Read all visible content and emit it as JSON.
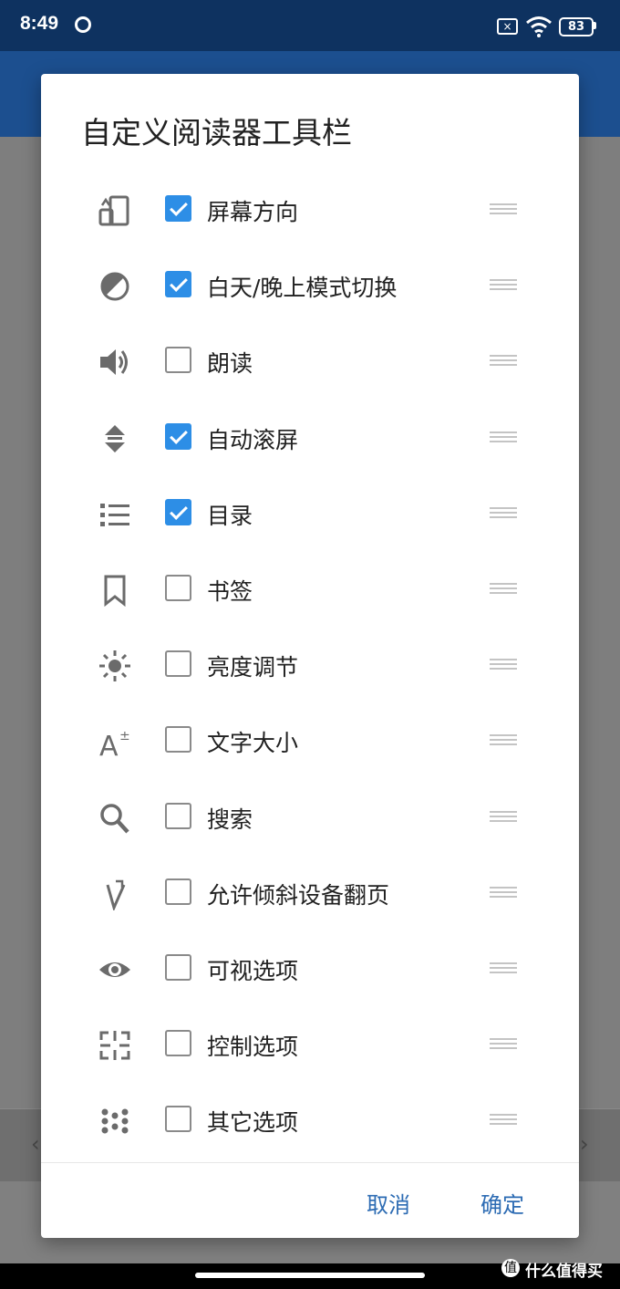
{
  "status_bar": {
    "time": "8:49",
    "battery": "83",
    "sim_icon": "sim-card-x-icon",
    "wifi_icon": "wifi-icon"
  },
  "dialog": {
    "title": "自定义阅读器工具栏",
    "items": [
      {
        "label": "屏幕方向",
        "checked": true,
        "icon": "screen-rotation-icon"
      },
      {
        "label": "白天/晚上模式切换",
        "checked": true,
        "icon": "day-night-icon"
      },
      {
        "label": "朗读",
        "checked": false,
        "icon": "speaker-icon"
      },
      {
        "label": "自动滚屏",
        "checked": true,
        "icon": "auto-scroll-icon"
      },
      {
        "label": "目录",
        "checked": true,
        "icon": "toc-list-icon"
      },
      {
        "label": "书签",
        "checked": false,
        "icon": "bookmark-icon"
      },
      {
        "label": "亮度调节",
        "checked": false,
        "icon": "brightness-icon"
      },
      {
        "label": "文字大小",
        "checked": false,
        "icon": "text-size-icon"
      },
      {
        "label": "搜索",
        "checked": false,
        "icon": "search-icon"
      },
      {
        "label": "允许倾斜设备翻页",
        "checked": false,
        "icon": "tilt-page-icon"
      },
      {
        "label": "可视选项",
        "checked": false,
        "icon": "eye-icon"
      },
      {
        "label": "控制选项",
        "checked": false,
        "icon": "control-crosshair-icon"
      },
      {
        "label": "其它选项",
        "checked": false,
        "icon": "dots-pattern-icon"
      }
    ],
    "cancel_label": "取消",
    "ok_label": "确定"
  },
  "watermark": "什么值得买",
  "colors": {
    "status_bar": "#0e3260",
    "app_bar": "#1c4f8f",
    "checkbox_checked": "#2d8ee6",
    "button_text": "#2c6bb3",
    "scrim": "#7e7e7e"
  }
}
